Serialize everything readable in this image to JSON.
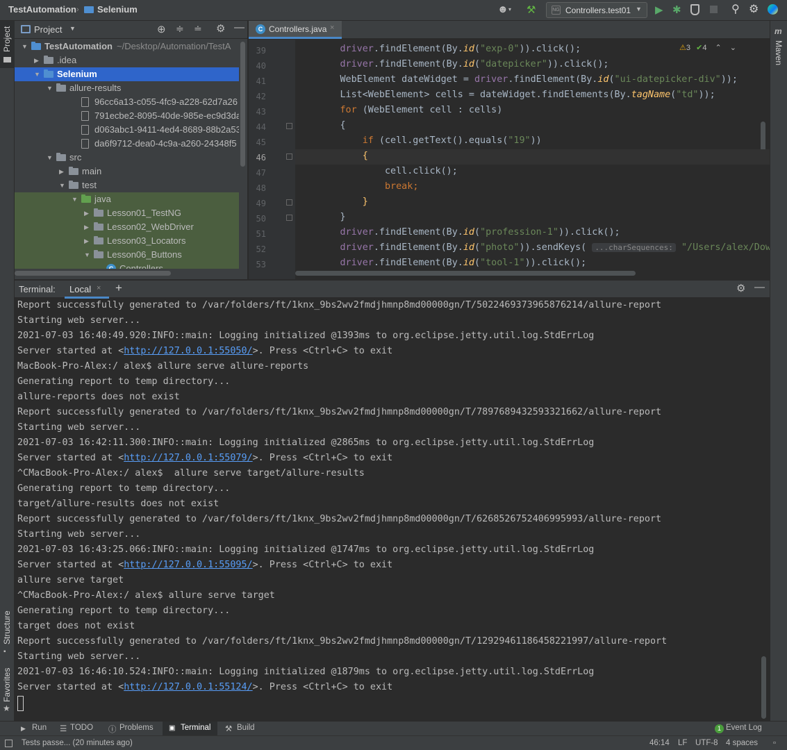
{
  "breadcrumbs": {
    "project": "TestAutomation",
    "module": "Selenium"
  },
  "run_config": {
    "label": "Controllers.test01"
  },
  "side_labels": {
    "project": "Project",
    "structure": "Structure",
    "favorites": "Favorites",
    "maven": "Maven"
  },
  "project_panel": {
    "title": "Project",
    "tree": [
      {
        "label": "TestAutomation",
        "suffix": "~/Desktop/Automation/TestA",
        "type": "module",
        "indent": 0,
        "expanded": true
      },
      {
        "label": ".idea",
        "type": "folder",
        "indent": 1,
        "expanded": false
      },
      {
        "label": "Selenium",
        "type": "module",
        "indent": 1,
        "expanded": true,
        "selected": true
      },
      {
        "label": "allure-results",
        "type": "folder",
        "indent": 2,
        "expanded": true
      },
      {
        "label": "96cc6a13-c055-4fc9-a228-62d7a26",
        "type": "file",
        "indent": 4
      },
      {
        "label": "791ecbe2-8095-40de-985e-ec9d3da",
        "type": "file",
        "indent": 4
      },
      {
        "label": "d063abc1-9411-4ed4-8689-88b2a53",
        "type": "file",
        "indent": 4
      },
      {
        "label": "da6f9712-dea0-4c9a-a260-24348f5",
        "type": "file",
        "indent": 4
      },
      {
        "label": "src",
        "type": "folder",
        "indent": 2,
        "expanded": true
      },
      {
        "label": "main",
        "type": "folder",
        "indent": 3,
        "expanded": false
      },
      {
        "label": "test",
        "type": "folder",
        "indent": 3,
        "expanded": true
      },
      {
        "label": "java",
        "type": "srcfolder",
        "indent": 4,
        "expanded": true,
        "green": true
      },
      {
        "label": "Lesson01_TestNG",
        "type": "package",
        "indent": 5,
        "expanded": false,
        "green": true
      },
      {
        "label": "Lesson02_WebDriver",
        "type": "package",
        "indent": 5,
        "expanded": false,
        "green": true
      },
      {
        "label": "Lesson03_Locators",
        "type": "package",
        "indent": 5,
        "expanded": false,
        "green": true
      },
      {
        "label": "Lesson06_Buttons",
        "type": "package",
        "indent": 5,
        "expanded": true,
        "green": true
      },
      {
        "label": "Controllers",
        "type": "class",
        "indent": 6,
        "green": true
      }
    ]
  },
  "editor": {
    "tab": "Controllers.java",
    "inspections": {
      "warnings": "3",
      "ok": "4"
    },
    "current_line": "46",
    "lines": [
      {
        "n": "39",
        "t": [
          [
            "        ",
            ""
          ],
          [
            "driver",
            "fld"
          ],
          [
            ".findElement(By.",
            ""
          ],
          [
            "id",
            "mth it"
          ],
          [
            "(",
            ""
          ],
          [
            "\"exp-0\"",
            "str"
          ],
          [
            ")).click();",
            ""
          ]
        ]
      },
      {
        "n": "40",
        "t": [
          [
            "        ",
            ""
          ],
          [
            "driver",
            "fld"
          ],
          [
            ".findElement(By.",
            ""
          ],
          [
            "id",
            "mth it"
          ],
          [
            "(",
            ""
          ],
          [
            "\"datepicker\"",
            "str"
          ],
          [
            ")).click();",
            ""
          ]
        ]
      },
      {
        "n": "41",
        "t": [
          [
            "        WebElement dateWidget = ",
            ""
          ],
          [
            "driver",
            "fld"
          ],
          [
            ".findElement(By.",
            ""
          ],
          [
            "id",
            "mth it"
          ],
          [
            "(",
            ""
          ],
          [
            "\"ui-datepicker-div\"",
            "str"
          ],
          [
            "));",
            ""
          ]
        ]
      },
      {
        "n": "42",
        "t": [
          [
            "        List<WebElement> cells = dateWidget.findElements(By.",
            ""
          ],
          [
            "tagName",
            "mth it"
          ],
          [
            "(",
            ""
          ],
          [
            "\"td\"",
            "str"
          ],
          [
            "));",
            ""
          ]
        ]
      },
      {
        "n": "43",
        "t": [
          [
            "        ",
            ""
          ],
          [
            "for",
            "kw"
          ],
          [
            " (WebElement cell : cells)",
            ""
          ]
        ]
      },
      {
        "n": "44",
        "t": [
          [
            "        {",
            ""
          ]
        ]
      },
      {
        "n": "45",
        "t": [
          [
            "            ",
            ""
          ],
          [
            "if",
            "kw"
          ],
          [
            " (cell.getText().equals(",
            ""
          ],
          [
            "\"19\"",
            "str"
          ],
          [
            "))",
            ""
          ]
        ]
      },
      {
        "n": "46",
        "t": [
          [
            "            ",
            ""
          ],
          [
            "{",
            "mth"
          ]
        ]
      },
      {
        "n": "47",
        "t": [
          [
            "                cell.click();",
            ""
          ]
        ]
      },
      {
        "n": "48",
        "t": [
          [
            "                ",
            ""
          ],
          [
            "break",
            "kw"
          ],
          [
            ";",
            "kw"
          ]
        ]
      },
      {
        "n": "49",
        "t": [
          [
            "            ",
            ""
          ],
          [
            "}",
            "mth"
          ]
        ]
      },
      {
        "n": "50",
        "t": [
          [
            "        }",
            ""
          ]
        ]
      },
      {
        "n": "51",
        "t": [
          [
            "        ",
            ""
          ],
          [
            "driver",
            "fld"
          ],
          [
            ".findElement(By.",
            ""
          ],
          [
            "id",
            "mth it"
          ],
          [
            "(",
            ""
          ],
          [
            "\"profession-1\"",
            "str"
          ],
          [
            ")).click();",
            ""
          ]
        ]
      },
      {
        "n": "52",
        "t": [
          [
            "        ",
            ""
          ],
          [
            "driver",
            "fld"
          ],
          [
            ".findElement(By.",
            ""
          ],
          [
            "id",
            "mth it"
          ],
          [
            "(",
            ""
          ],
          [
            "\"photo\"",
            "str"
          ],
          [
            ")).sendKeys( ",
            ""
          ],
          [
            "...charSequences:",
            "hint"
          ],
          [
            " \"/Users/alex/Downlo",
            "str"
          ]
        ]
      },
      {
        "n": "53",
        "t": [
          [
            "        ",
            ""
          ],
          [
            "driver",
            "fld"
          ],
          [
            ".findElement(By.",
            ""
          ],
          [
            "id",
            "mth it"
          ],
          [
            "(",
            ""
          ],
          [
            "\"tool-1\"",
            "str"
          ],
          [
            ")).click();",
            ""
          ]
        ]
      }
    ]
  },
  "terminal": {
    "title": "Terminal:",
    "tab": "Local",
    "lines": [
      "Report successfully generated to /var/folders/ft/1knx_9bs2wv2fmdjhmnp8md00000gn/T/5022469373965876214/allure-report",
      "Starting web server...",
      "2021-07-03 16:40:49.920:INFO::main: Logging initialized @1393ms to org.eclipse.jetty.util.log.StdErrLog",
      {
        "pre": "Server started at <",
        "link": "http://127.0.0.1:55050/",
        "post": ">. Press <Ctrl+C> to exit"
      },
      "MacBook-Pro-Alex:/ alex$ allure serve allure-reports",
      "Generating report to temp directory...",
      "allure-reports does not exist",
      "Report successfully generated to /var/folders/ft/1knx_9bs2wv2fmdjhmnp8md00000gn/T/7897689432593321662/allure-report",
      "Starting web server...",
      "2021-07-03 16:42:11.300:INFO::main: Logging initialized @2865ms to org.eclipse.jetty.util.log.StdErrLog",
      {
        "pre": "Server started at <",
        "link": "http://127.0.0.1:55079/",
        "post": ">. Press <Ctrl+C> to exit"
      },
      "^CMacBook-Pro-Alex:/ alex$  allure serve target/allure-results",
      "Generating report to temp directory...",
      "target/allure-results does not exist",
      "Report successfully generated to /var/folders/ft/1knx_9bs2wv2fmdjhmnp8md00000gn/T/6268526752406995993/allure-report",
      "Starting web server...",
      "2021-07-03 16:43:25.066:INFO::main: Logging initialized @1747ms to org.eclipse.jetty.util.log.StdErrLog",
      {
        "pre": "Server started at <",
        "link": "http://127.0.0.1:55095/",
        "post": ">. Press <Ctrl+C> to exit"
      },
      "allure serve target",
      "^CMacBook-Pro-Alex:/ alex$ allure serve target",
      "Generating report to temp directory...",
      "target does not exist",
      "Report successfully generated to /var/folders/ft/1knx_9bs2wv2fmdjhmnp8md00000gn/T/12929461186458221997/allure-report",
      "Starting web server...",
      "2021-07-03 16:46:10.524:INFO::main: Logging initialized @1879ms to org.eclipse.jetty.util.log.StdErrLog",
      {
        "pre": "Server started at <",
        "link": "http://127.0.0.1:55124/",
        "post": ">. Press <Ctrl+C> to exit"
      }
    ]
  },
  "bottom_tabs": {
    "run": "Run",
    "todo": "TODO",
    "problems": "Problems",
    "terminal": "Terminal",
    "build": "Build",
    "event_log": "Event Log",
    "event_count": "1"
  },
  "status": {
    "message": "Tests passe... (20 minutes ago)",
    "position": "46:14",
    "line_sep": "LF",
    "encoding": "UTF-8",
    "indent": "4 spaces"
  },
  "colors": {
    "selection": "#2f65ca",
    "link": "#589df6",
    "keyword": "#cc7832",
    "string": "#6a8759",
    "field": "#9876aa",
    "method": "#ffc66d"
  }
}
